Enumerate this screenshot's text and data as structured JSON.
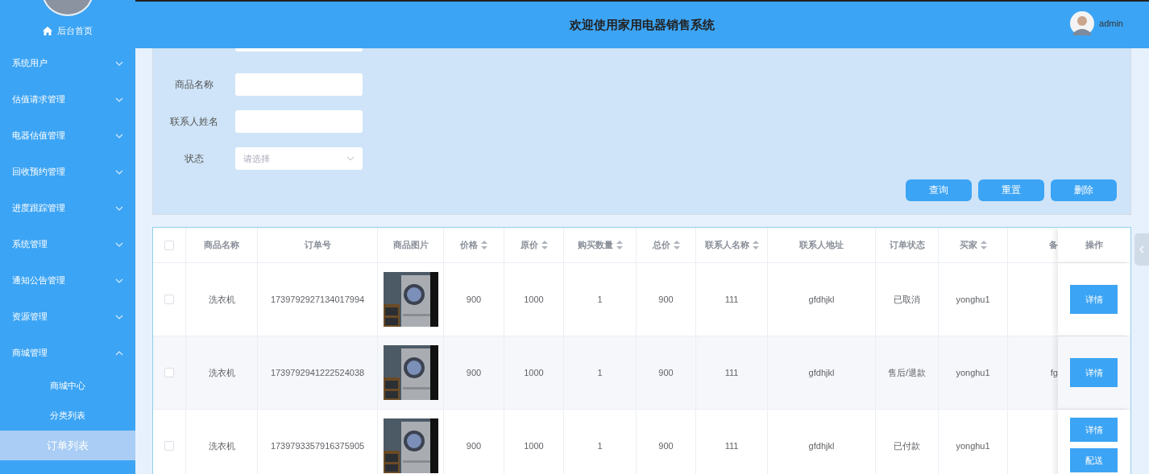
{
  "sidebar": {
    "home": "后台首页",
    "items": [
      {
        "label": "系统用户",
        "expanded": false
      },
      {
        "label": "估值请求管理",
        "expanded": false
      },
      {
        "label": "电器估值管理",
        "expanded": false
      },
      {
        "label": "回收预约管理",
        "expanded": false
      },
      {
        "label": "进度跟踪管理",
        "expanded": false
      },
      {
        "label": "系统管理",
        "expanded": false
      },
      {
        "label": "通知公告管理",
        "expanded": false
      },
      {
        "label": "资源管理",
        "expanded": false
      },
      {
        "label": "商城管理",
        "expanded": true,
        "children": [
          {
            "label": "商城中心",
            "selected": false
          },
          {
            "label": "分类列表",
            "selected": false
          },
          {
            "label": "订单列表",
            "selected": true
          }
        ]
      }
    ]
  },
  "header": {
    "title": "欢迎使用家用电器销售系统",
    "user": "admin"
  },
  "search": {
    "fields": [
      {
        "label": "商品名称",
        "kind": "input"
      },
      {
        "label": "联系人姓名",
        "kind": "input"
      },
      {
        "label": "状态",
        "kind": "select",
        "placeholder": "请选择"
      }
    ],
    "buttons": [
      "查询",
      "重置",
      "删除"
    ]
  },
  "table": {
    "select_all": {
      "checked": false
    },
    "columns": [
      {
        "label": "商品名称",
        "sortable": false
      },
      {
        "label": "订单号",
        "sortable": false
      },
      {
        "label": "商品图片",
        "sortable": false
      },
      {
        "label": "价格",
        "sortable": true
      },
      {
        "label": "原价",
        "sortable": true
      },
      {
        "label": "购买数量",
        "sortable": true
      },
      {
        "label": "总价",
        "sortable": true
      },
      {
        "label": "联系人名称",
        "sortable": true
      },
      {
        "label": "联系人地址",
        "sortable": false
      },
      {
        "label": "订单状态",
        "sortable": false
      },
      {
        "label": "买家",
        "sortable": true
      },
      {
        "label": "备",
        "sortable": false
      },
      {
        "label": "操作",
        "sortable": false
      }
    ],
    "rows": [
      {
        "checked": false,
        "cells": [
          "洗衣机",
          "1739792927134017994",
          {
            "kind": "picture"
          },
          "900",
          "1000",
          "1",
          "900",
          "111",
          "gfdhjkl",
          "已取消",
          "yonghu1"
        ],
        "actions": [
          "详情"
        ]
      },
      {
        "checked": false,
        "cells": [
          "洗衣机",
          "1739792941222524038",
          {
            "kind": "picture"
          },
          "900",
          "1000",
          "1",
          "900",
          "111",
          "gfdhjkl",
          "售后/退款",
          "yonghu1",
          "fg"
        ],
        "actions": [
          "详情"
        ]
      },
      {
        "checked": false,
        "cells": [
          "洗衣机",
          "1739793357916375905",
          {
            "kind": "picture"
          },
          "900",
          "1000",
          "1",
          "900",
          "111",
          "gfdhjkl",
          "已付款",
          "yonghu1"
        ],
        "actions": [
          "详情",
          "配送"
        ]
      }
    ]
  }
}
